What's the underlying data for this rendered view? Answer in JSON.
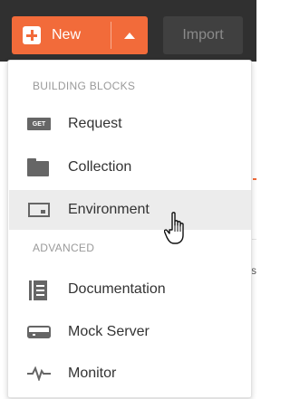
{
  "toolbar": {
    "new_label": "New",
    "import_label": "Import"
  },
  "menu": {
    "sections": [
      {
        "header": "BUILDING BLOCKS",
        "items": [
          {
            "label": "Request",
            "icon": "get-request-icon",
            "icon_text": "GET"
          },
          {
            "label": "Collection",
            "icon": "folder-icon"
          },
          {
            "label": "Environment",
            "icon": "environment-icon",
            "hovered": true
          }
        ]
      },
      {
        "header": "ADVANCED",
        "items": [
          {
            "label": "Documentation",
            "icon": "documentation-icon"
          },
          {
            "label": "Mock Server",
            "icon": "mock-server-icon"
          },
          {
            "label": "Monitor",
            "icon": "pulse-icon"
          }
        ]
      }
    ]
  },
  "background": {
    "partial_text": "s"
  },
  "colors": {
    "accent": "#f26b3a",
    "topbar": "#303030",
    "hover": "#ececec",
    "text": "#333333",
    "section_header": "#9a9a9a"
  }
}
